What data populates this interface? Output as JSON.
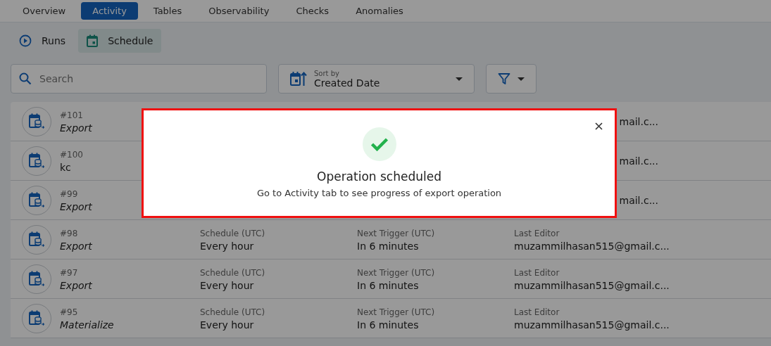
{
  "tabs": [
    {
      "label": "Overview",
      "selected": false
    },
    {
      "label": "Activity",
      "selected": true
    },
    {
      "label": "Tables",
      "selected": false
    },
    {
      "label": "Observability",
      "selected": false
    },
    {
      "label": "Checks",
      "selected": false
    },
    {
      "label": "Anomalies",
      "selected": false
    }
  ],
  "subtabs": [
    {
      "label": "Runs",
      "kind": "runs",
      "selected": false
    },
    {
      "label": "Schedule",
      "kind": "schedule",
      "selected": true
    }
  ],
  "search": {
    "placeholder": "Search"
  },
  "sort": {
    "label": "Sort by",
    "value": "Created Date"
  },
  "rows": [
    {
      "id": "#101",
      "name": "Export",
      "italic": true,
      "editor": "mail.c..."
    },
    {
      "id": "#100",
      "name": "kc",
      "italic": false,
      "editor": "mail.c..."
    },
    {
      "id": "#99",
      "name": "Export",
      "italic": true,
      "editor": "mail.c..."
    },
    {
      "id": "#98",
      "name": "Export",
      "italic": true,
      "schedule_label": "Schedule (UTC)",
      "schedule": "Every hour",
      "next_label": "Next Trigger (UTC)",
      "next": "In 6 minutes",
      "editor_label": "Last Editor",
      "editor": "muzammilhasan515@gmail.c..."
    },
    {
      "id": "#97",
      "name": "Export",
      "italic": true,
      "schedule_label": "Schedule (UTC)",
      "schedule": "Every hour",
      "next_label": "Next Trigger (UTC)",
      "next": "In 6 minutes",
      "editor_label": "Last Editor",
      "editor": "muzammilhasan515@gmail.c..."
    },
    {
      "id": "#95",
      "name": "Materialize",
      "italic": true,
      "schedule_label": "Schedule (UTC)",
      "schedule": "Every hour",
      "next_label": "Next Trigger (UTC)",
      "next": "In 6 minutes",
      "editor_label": "Last Editor",
      "editor": "muzammilhasan515@gmail.c..."
    }
  ],
  "dialog": {
    "title": "Operation scheduled",
    "message": "Go to Activity tab to see progress of export operation"
  }
}
